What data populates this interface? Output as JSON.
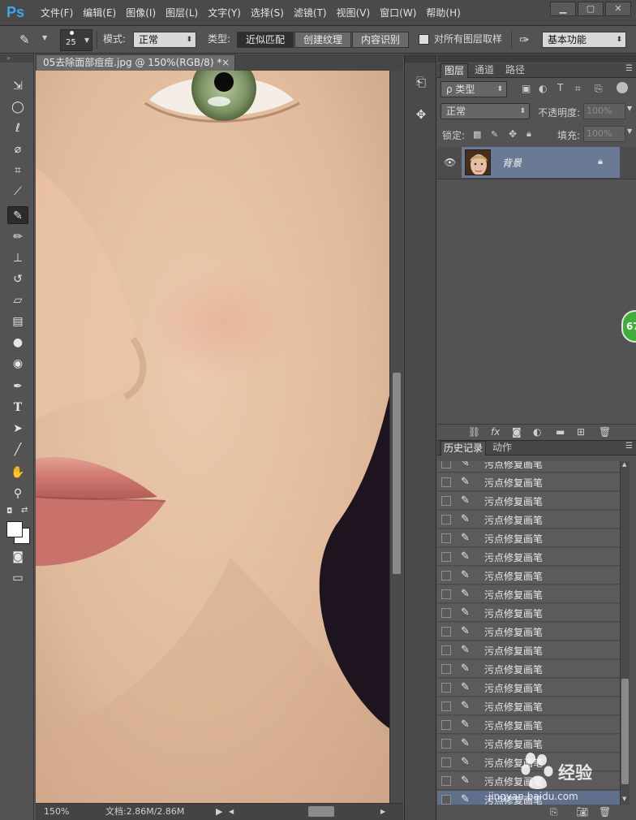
{
  "app": {
    "logo": "Ps"
  },
  "menu": [
    "文件(F)",
    "编辑(E)",
    "图像(I)",
    "图层(L)",
    "文字(Y)",
    "选择(S)",
    "滤镜(T)",
    "视图(V)",
    "窗口(W)",
    "帮助(H)"
  ],
  "window_controls": [
    "▁",
    "▢",
    "✕"
  ],
  "options": {
    "brush_size": "25",
    "mode_label": "模式:",
    "mode_value": "正常",
    "type_label": "类型:",
    "type_options": [
      "近似匹配",
      "创建纹理",
      "内容识别"
    ],
    "sample_all_label": "对所有图层取样",
    "workspace": "基本功能"
  },
  "document": {
    "tab_title": "05去除面部痘痘.jpg @ 150%(RGB/8) *",
    "close_glyph": "×",
    "zoom": "150%",
    "doc_info": "文档:2.86M/2.86M"
  },
  "layers_panel": {
    "tabs": [
      "图层",
      "通道",
      "路径"
    ],
    "filter_label": "ρ 类型",
    "blend_mode": "正常",
    "opacity_label": "不透明度:",
    "opacity_value": "100%",
    "lock_label": "锁定:",
    "fill_label": "填充:",
    "fill_value": "100%",
    "layer_name": "背景"
  },
  "history_panel": {
    "tabs": [
      "历史记录",
      "动作"
    ],
    "items": [
      "污点修复画笔",
      "污点修复画笔",
      "污点修复画笔",
      "污点修复画笔",
      "污点修复画笔",
      "污点修复画笔",
      "污点修复画笔",
      "污点修复画笔",
      "污点修复画笔",
      "污点修复画笔",
      "污点修复画笔",
      "污点修复画笔",
      "污点修复画笔",
      "污点修复画笔",
      "污点修复画笔",
      "污点修复画笔",
      "污点修复画笔",
      "污点修复画笔",
      "污点修复画笔"
    ]
  },
  "overlay": {
    "badge": "67",
    "watermark_main": "经验",
    "watermark_sub": "jingyan.baidu.com"
  }
}
